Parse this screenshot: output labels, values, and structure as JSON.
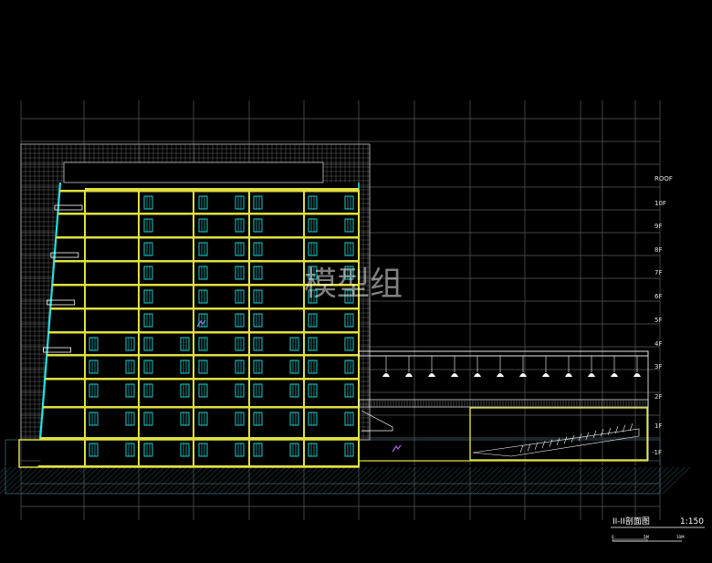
{
  "drawing": {
    "watermark": "模型组",
    "title": "II-II剖面图",
    "scale": "1:150",
    "scale_bar_labels": [
      "0",
      "5M",
      "10M"
    ],
    "levels": [
      "ROOF",
      "10F",
      "9F",
      "8F",
      "7F",
      "6F",
      "5F",
      "4F",
      "3F",
      "2F",
      "1F",
      "-1F"
    ]
  },
  "colors": {
    "background": "#000000",
    "structure": "#e0e040",
    "facade": "#20e0e0",
    "grid": "#5a5a5a",
    "hatch": "#3a6a78",
    "text": "#ffffff",
    "accent": "#b060e0"
  }
}
